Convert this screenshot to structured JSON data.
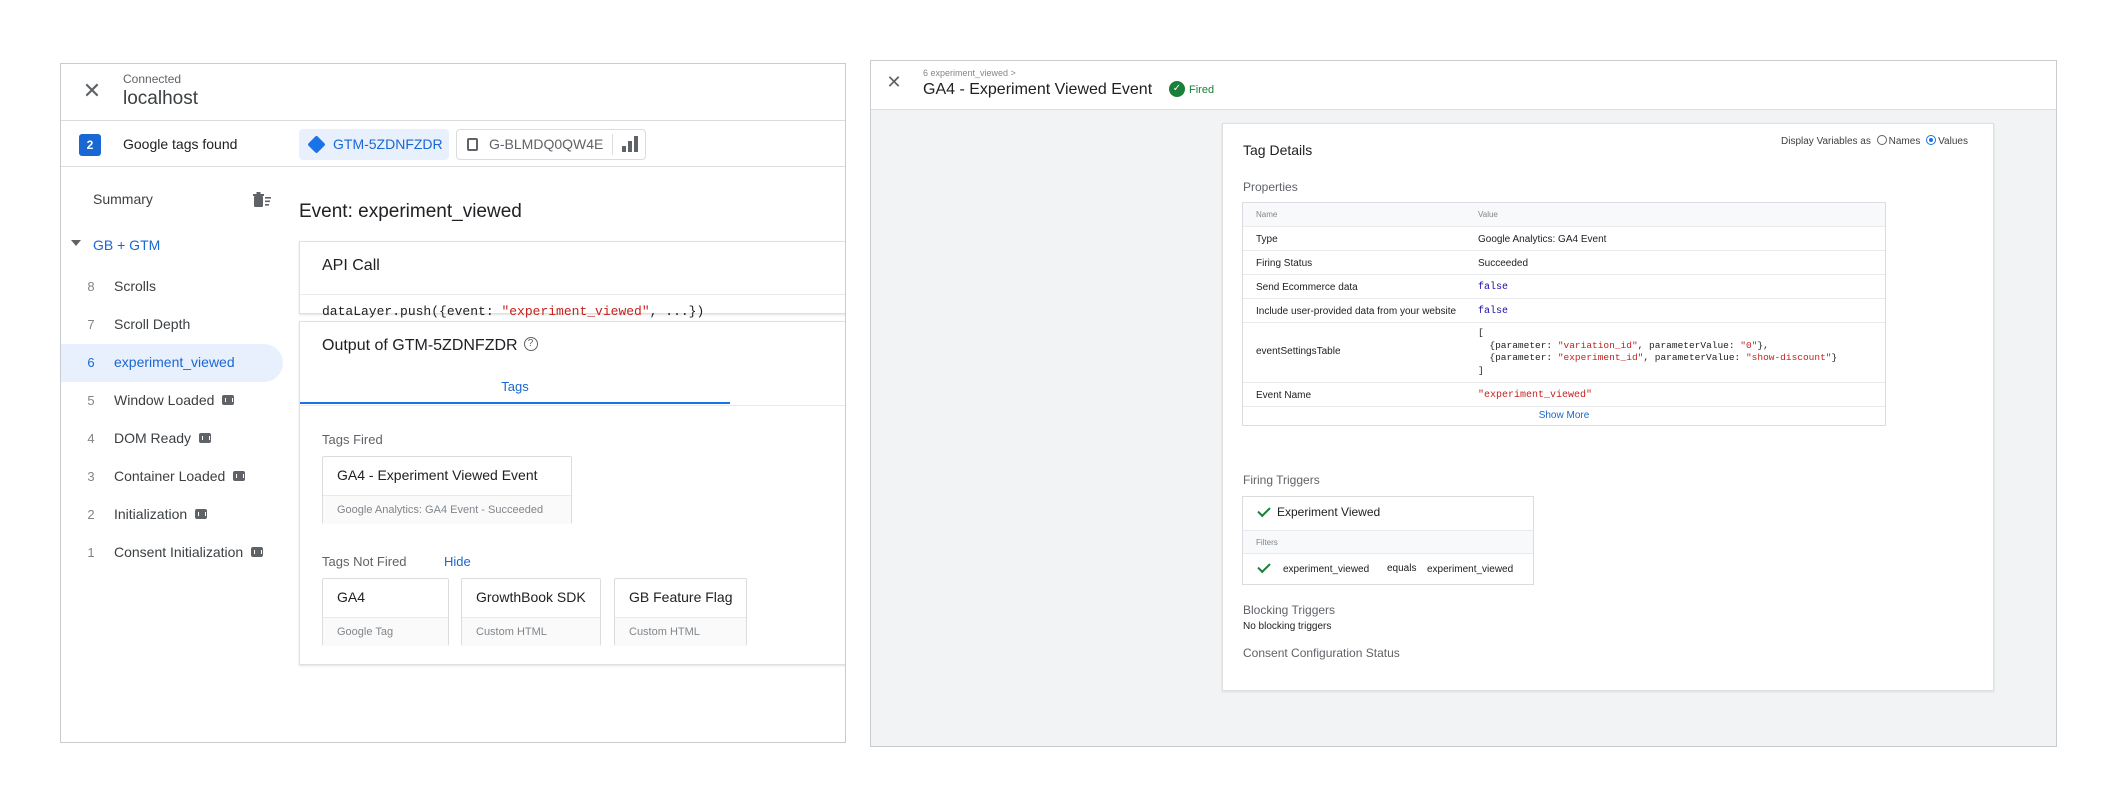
{
  "left_panel": {
    "status": "Connected",
    "host": "localhost",
    "tags_count": "2",
    "tags_found_label": "Google tags found",
    "container_tabs": [
      {
        "label": "GTM-5ZDNFZDR"
      },
      {
        "label": "G-BLMDQ0QW4E"
      }
    ],
    "summary_label": "Summary",
    "group_label": "GB + GTM",
    "events": [
      {
        "num": "8",
        "label": "Scrolls",
        "has_code_icon": false
      },
      {
        "num": "7",
        "label": "Scroll Depth",
        "has_code_icon": false
      },
      {
        "num": "6",
        "label": "experiment_viewed",
        "has_code_icon": false,
        "selected": true
      },
      {
        "num": "5",
        "label": "Window Loaded",
        "has_code_icon": true
      },
      {
        "num": "4",
        "label": "DOM Ready",
        "has_code_icon": true
      },
      {
        "num": "3",
        "label": "Container Loaded",
        "has_code_icon": true
      },
      {
        "num": "2",
        "label": "Initialization",
        "has_code_icon": true
      },
      {
        "num": "1",
        "label": "Consent Initialization",
        "has_code_icon": true
      }
    ],
    "event_title": "Event: experiment_viewed",
    "api_call": {
      "title": "API Call",
      "code_prefix": "dataLayer.push({event: ",
      "code_string": "\"experiment_viewed\"",
      "code_suffix": ", ...})"
    },
    "output": {
      "title": "Output of GTM-5ZDNFZDR",
      "tab_label": "Tags",
      "fired_label": "Tags Fired",
      "fired_tags": [
        {
          "name": "GA4 - Experiment Viewed Event",
          "sub": "Google Analytics: GA4 Event - Succeeded"
        }
      ],
      "not_fired_label": "Tags Not Fired",
      "hide_label": "Hide",
      "not_fired_tags": [
        {
          "name": "GA4",
          "sub": "Google Tag"
        },
        {
          "name": "GrowthBook SDK",
          "sub": "Custom HTML"
        },
        {
          "name": "GB Feature Flag",
          "sub": "Custom HTML"
        }
      ]
    }
  },
  "right_panel": {
    "breadcrumb": "6 experiment_viewed >",
    "title": "GA4 - Experiment Viewed Event",
    "status": "Fired",
    "details_title": "Tag Details",
    "display_as_label": "Display Variables as",
    "display_options": [
      "Names",
      "Values"
    ],
    "display_selected": "Values",
    "properties_label": "Properties",
    "table_headers": {
      "name": "Name",
      "value": "Value"
    },
    "properties": {
      "type": {
        "k": "Type",
        "v": "Google Analytics: GA4 Event"
      },
      "firing_status": {
        "k": "Firing Status",
        "v": "Succeeded"
      },
      "send_ecommerce": {
        "k": "Send Ecommerce data",
        "v": "false"
      },
      "user_provided": {
        "k": "Include user-provided data from your website",
        "v": "false"
      },
      "event_settings": {
        "k": "eventSettingsTable",
        "open": "[",
        "close": "]",
        "rows": [
          {
            "p1": "{parameter: ",
            "s1": "\"variation_id\"",
            "p2": ", parameterValue: ",
            "s2": "\"0\"",
            "p3": "},"
          },
          {
            "p1": "{parameter: ",
            "s1": "\"experiment_id\"",
            "p2": ", parameterValue: ",
            "s2": "\"show-discount\"",
            "p3": "}"
          }
        ]
      },
      "event_name": {
        "k": "Event Name",
        "v": "\"experiment_viewed\""
      }
    },
    "show_more": "Show More",
    "firing_triggers_label": "Firing Triggers",
    "trigger_name": "Experiment Viewed",
    "filters_label": "Filters",
    "filter": {
      "variable": "experiment_viewed",
      "operator": "equals",
      "value": "experiment_viewed"
    },
    "blocking_label": "Blocking Triggers",
    "blocking_none": "No blocking triggers",
    "consent_label": "Consent Configuration Status"
  },
  "colors": {
    "accent": "#1a73e8",
    "fired_green": "#188038",
    "string_red": "#c5221f"
  }
}
